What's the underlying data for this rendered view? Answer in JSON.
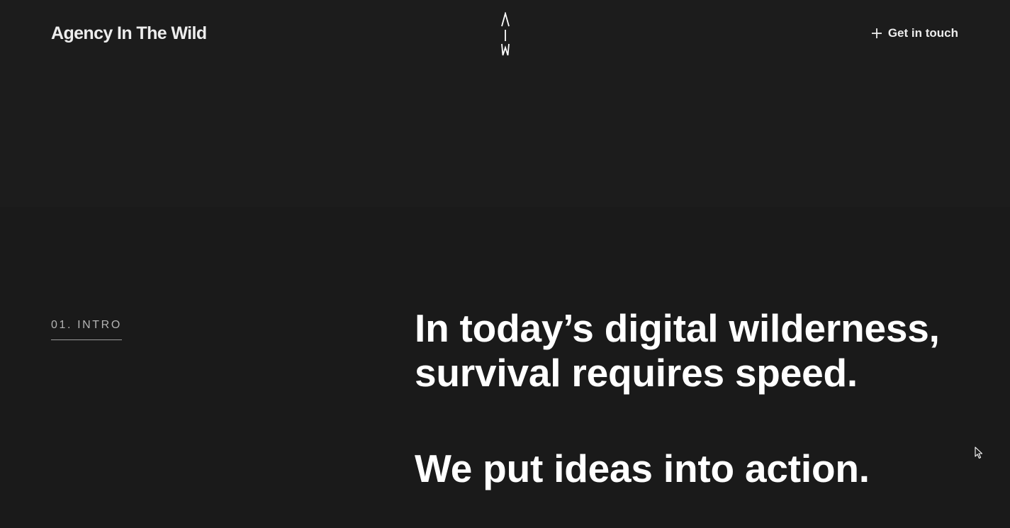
{
  "header": {
    "brand": "Agency In The Wild",
    "monogram_letters": [
      "A",
      "I",
      "W"
    ],
    "contact_label": "Get in touch",
    "contact_icon": "plus-icon"
  },
  "intro": {
    "section_label": "01. INTRO",
    "lines": [
      "In today’s digital wilderness, survival requires speed.",
      "We put ideas into action."
    ]
  },
  "colors": {
    "background": "#1a1a1a",
    "hero_band": "#1c1c1c",
    "text": "#ffffff",
    "muted_text": "#b4b4b4"
  },
  "cursor_icon": "mouse-pointer-icon"
}
